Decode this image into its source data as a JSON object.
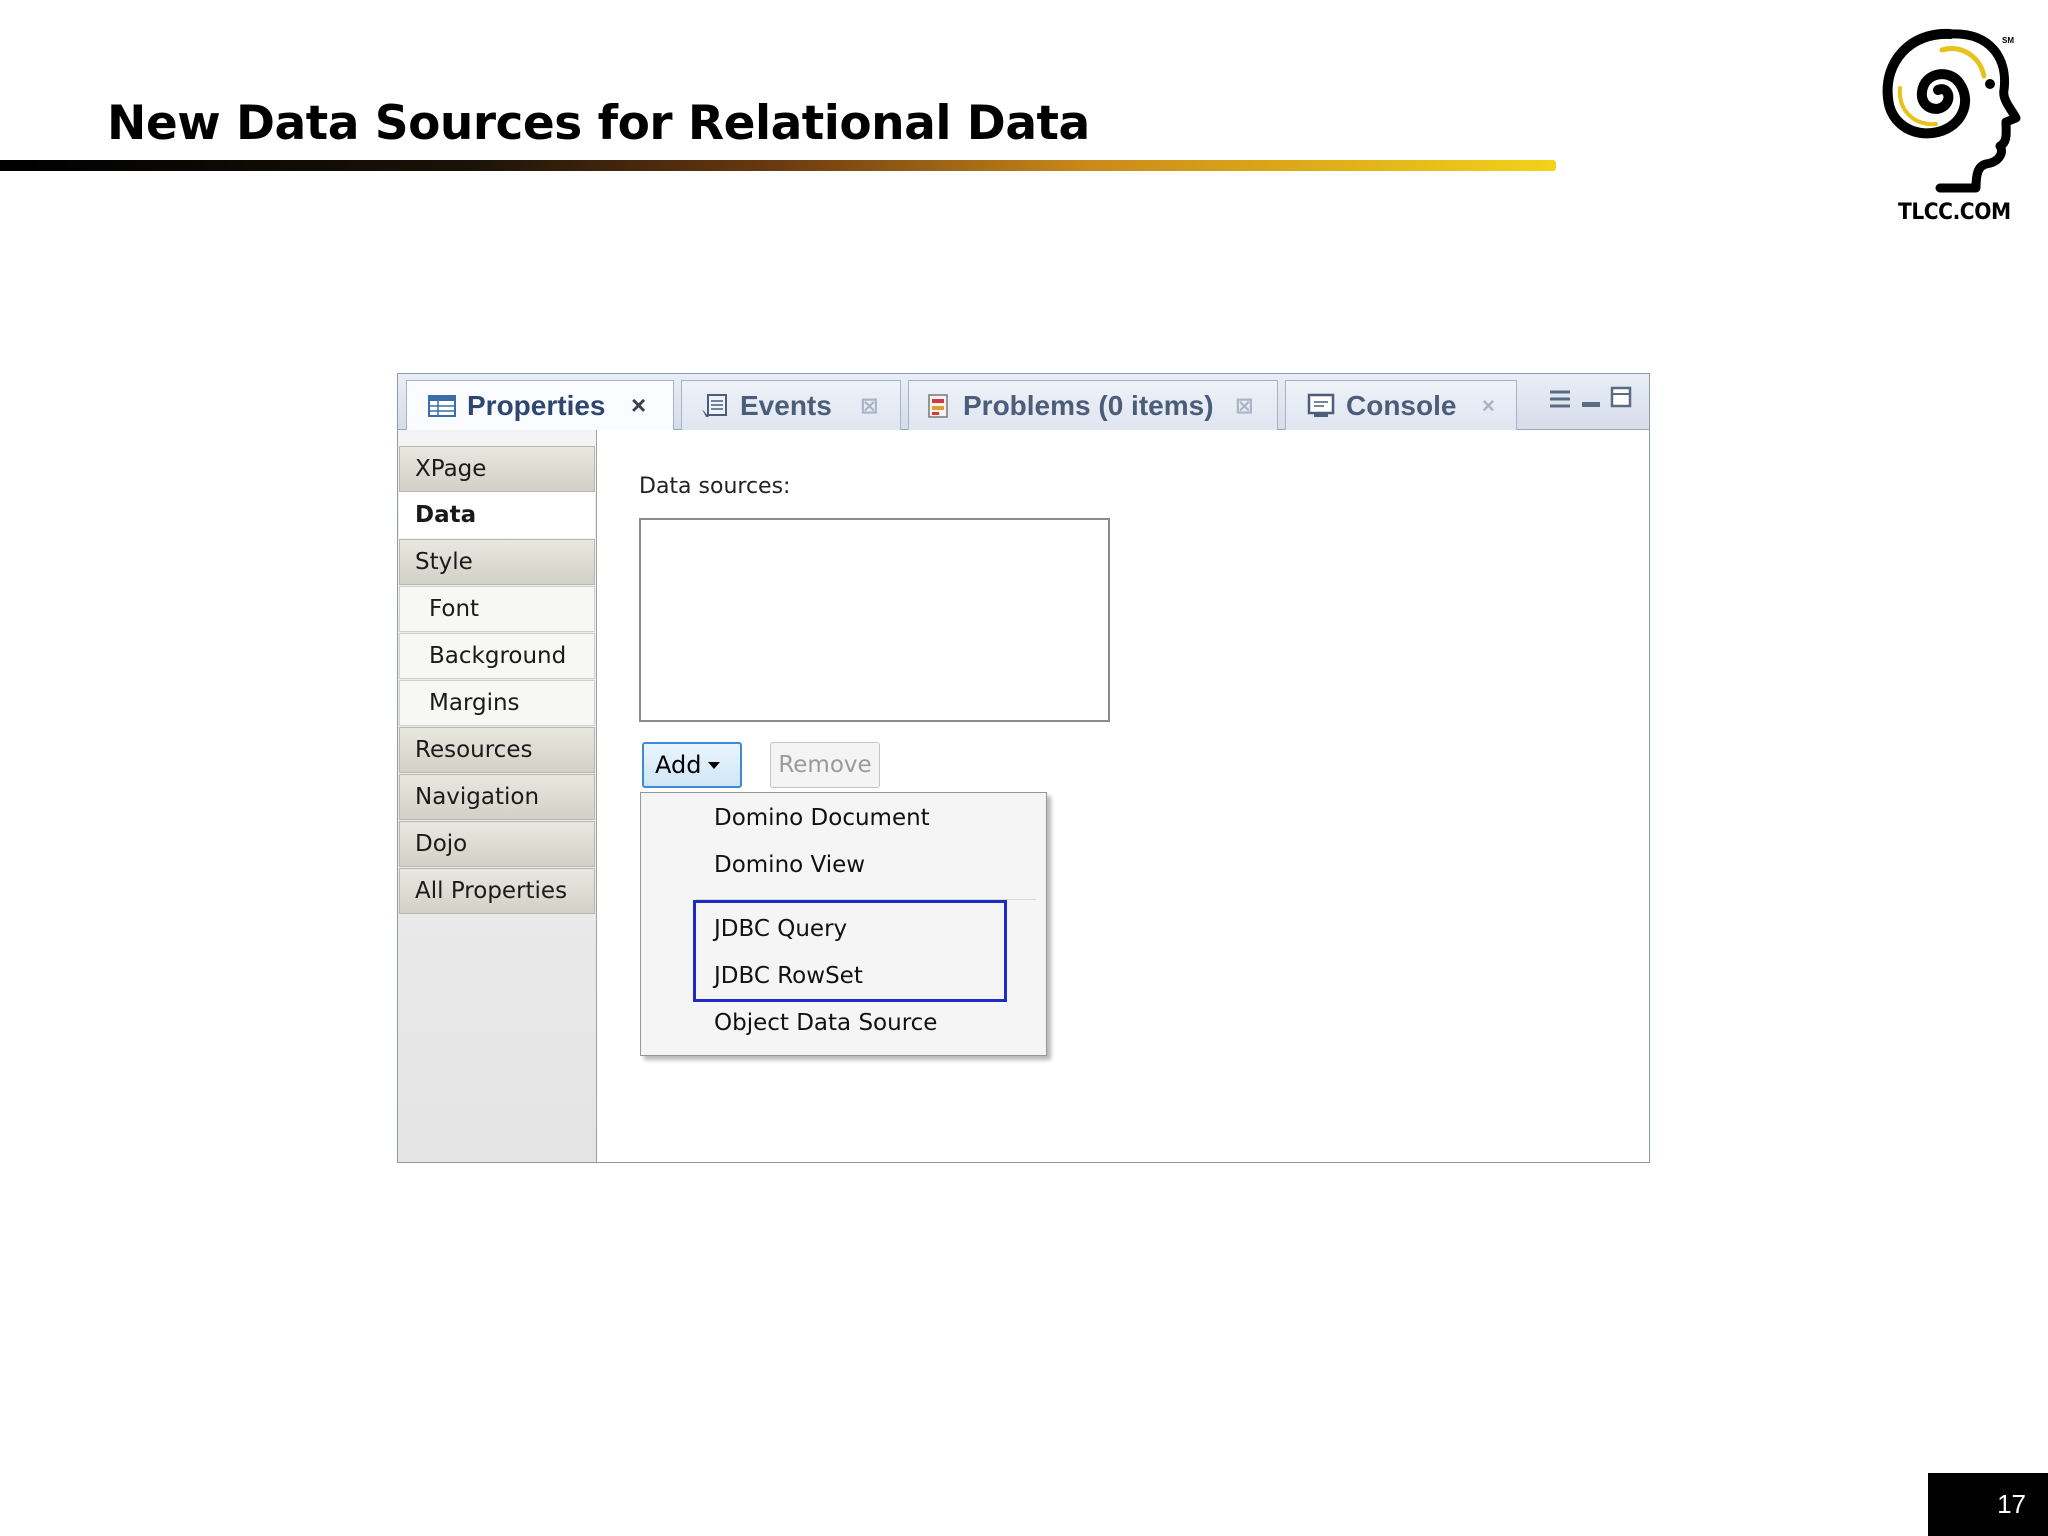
{
  "slide": {
    "title": "New Data Sources for Relational Data",
    "logo_text": "TLCC.COM",
    "logo_mark": "SM",
    "page_number": "17"
  },
  "tabs": [
    {
      "label": "Properties",
      "icon": "properties-table-icon",
      "close": "×"
    },
    {
      "label": "Events",
      "icon": "events-icon",
      "close": "⊠"
    },
    {
      "label": "Problems (0 items)",
      "icon": "problems-icon",
      "close": "⊠"
    },
    {
      "label": "Console",
      "icon": "console-icon",
      "close": "×"
    }
  ],
  "sidebar": {
    "items": [
      {
        "label": "XPage"
      },
      {
        "label": "Data"
      },
      {
        "label": "Style"
      },
      {
        "label": "Font"
      },
      {
        "label": "Background"
      },
      {
        "label": "Margins"
      },
      {
        "label": "Resources"
      },
      {
        "label": "Navigation"
      },
      {
        "label": "Dojo"
      },
      {
        "label": "All Properties"
      }
    ],
    "selected": "Data"
  },
  "main": {
    "data_sources_label": "Data sources:",
    "add_label": "Add",
    "remove_label": "Remove",
    "menu": [
      {
        "label": "Domino Document"
      },
      {
        "label": "Domino View"
      },
      {
        "label": "JDBC Query"
      },
      {
        "label": "JDBC RowSet"
      },
      {
        "label": "Object Data Source"
      }
    ],
    "highlight_color": "#1b2cc7"
  }
}
